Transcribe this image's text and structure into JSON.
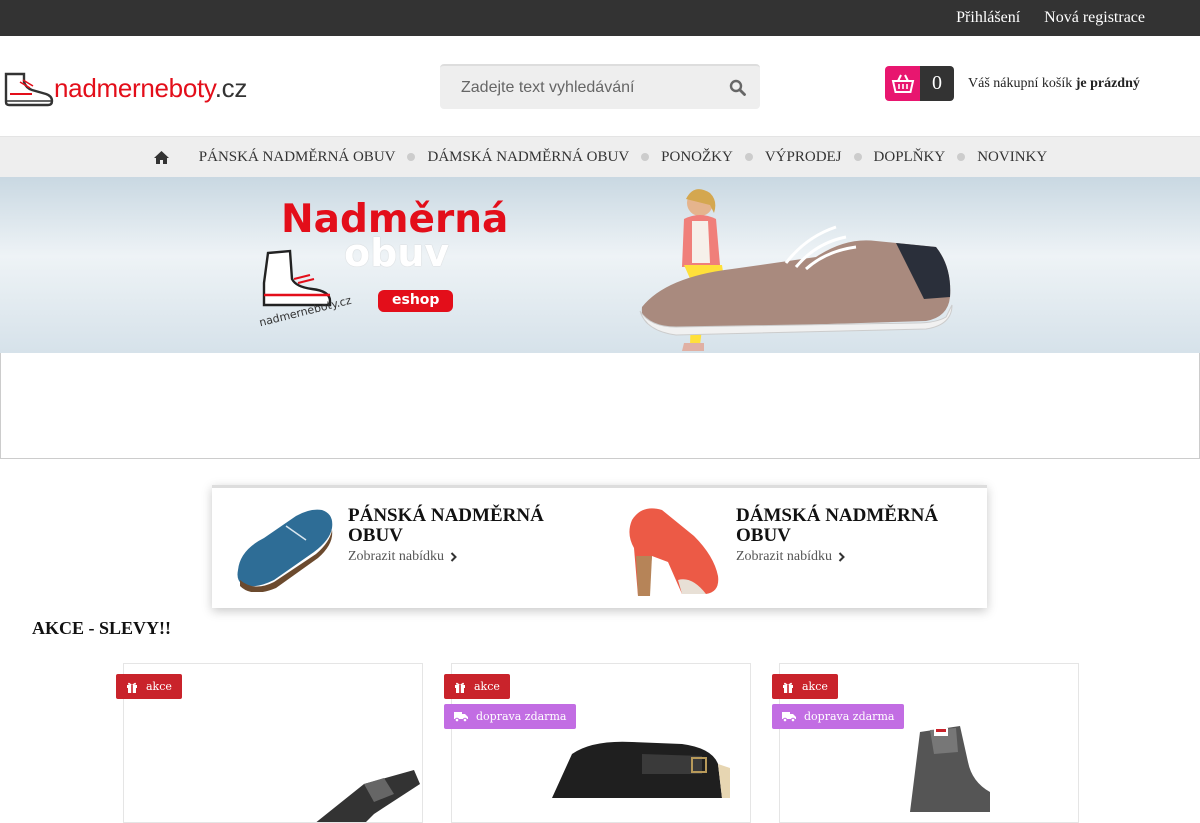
{
  "topbar": {
    "login": "Přihlášení",
    "register": "Nová registrace"
  },
  "logo": {
    "name": "nadmerneboty",
    "tld": ".cz"
  },
  "search": {
    "placeholder": "Zadejte text vyhledávání"
  },
  "cart": {
    "count": "0",
    "text_prefix": "Váš nákupní košík",
    "text_status": "je prázdný",
    "accent": "#e8166f"
  },
  "nav": {
    "items": [
      {
        "label": "PÁNSKÁ NADMĚRNÁ OBUV"
      },
      {
        "label": "DÁMSKÁ NADMĚRNÁ OBUV"
      },
      {
        "label": "PONOŽKY"
      },
      {
        "label": "VÝPRODEJ"
      },
      {
        "label": "DOPLŇKY"
      },
      {
        "label": "NOVINKY"
      }
    ]
  },
  "banner": {
    "title_line1": "Nadměrná",
    "title_line2": "obuv",
    "eshop": "eshop",
    "brand": "nadmerneboty.cz"
  },
  "categories": [
    {
      "title": "PÁNSKÁ NADMĚRNÁ OBUV",
      "link": "Zobrazit nabídku"
    },
    {
      "title": "DÁMSKÁ NADMĚRNÁ OBUV",
      "link": "Zobrazit nabídku"
    }
  ],
  "section": {
    "title": "AKCE - SLEVY!!"
  },
  "products": [
    {
      "badges": [
        "akce"
      ]
    },
    {
      "badges": [
        "akce",
        "doprava zdarma"
      ]
    },
    {
      "badges": [
        "akce",
        "doprava zdarma"
      ]
    }
  ],
  "colors": {
    "brand_red": "#e30e1a",
    "badge_red": "#c9232b",
    "badge_purple": "#c26de3",
    "topbar": "#333333"
  }
}
